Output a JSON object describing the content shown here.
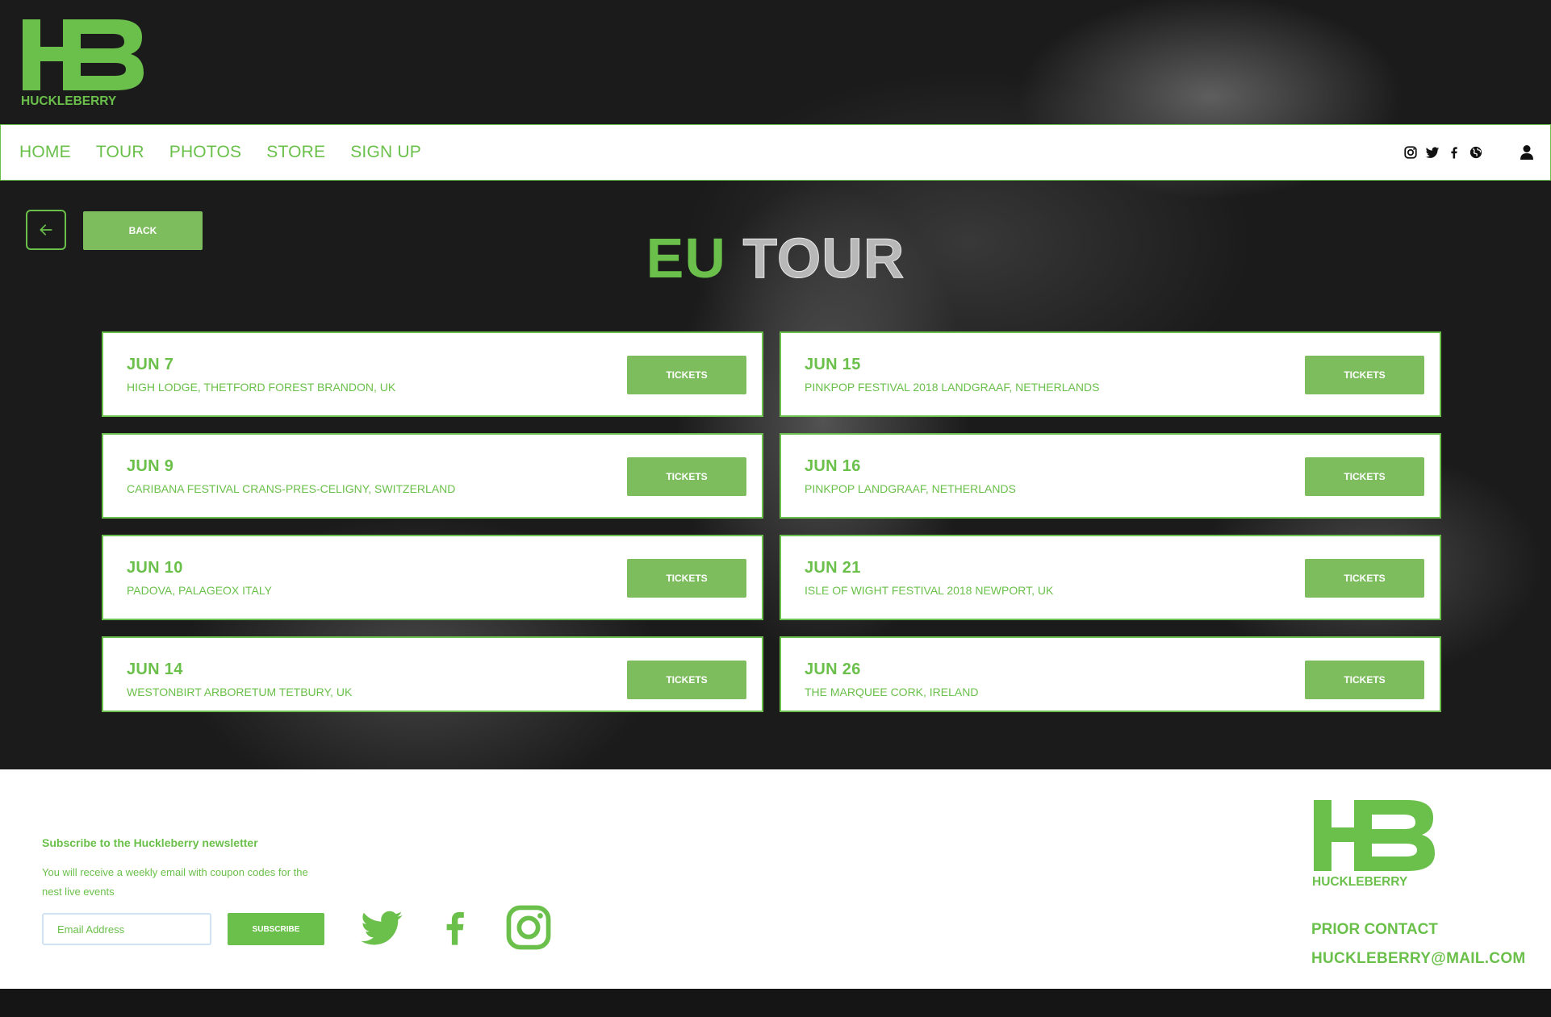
{
  "brand": {
    "logo_mark": "HB",
    "logo_name": "HUCKLEBERRY",
    "accent_color": "#6ac04a"
  },
  "nav": {
    "items": [
      {
        "label": "HOME"
      },
      {
        "label": "TOUR"
      },
      {
        "label": "PHOTOS"
      },
      {
        "label": "STORE"
      },
      {
        "label": "SIGN UP"
      }
    ],
    "icons": [
      "instagram-icon",
      "twitter-icon",
      "facebook-icon",
      "globe-icon",
      "user-icon"
    ]
  },
  "controls": {
    "back_label": "BACK"
  },
  "page": {
    "title_accent": "EU",
    "title_rest": "TOUR"
  },
  "tour": {
    "tickets_label": "TICKETS",
    "dates": [
      {
        "date": "JUN 7",
        "venue": "HIGH LODGE, THETFORD FOREST BRANDON, UK"
      },
      {
        "date": "JUN 15",
        "venue": "PINKPOP FESTIVAL 2018 LANDGRAAF, NETHERLANDS"
      },
      {
        "date": "JUN 9",
        "venue": "CARIBANA FESTIVAL CRANS-PRES-CELIGNY, SWITZERLAND"
      },
      {
        "date": "JUN 16",
        "venue": "PINKPOP LANDGRAAF, NETHERLANDS"
      },
      {
        "date": "JUN 10",
        "venue": "PADOVA, PALAGEOX ITALY"
      },
      {
        "date": "JUN 21",
        "venue": "ISLE OF WIGHT FESTIVAL 2018 NEWPORT, UK"
      },
      {
        "date": "JUN 14",
        "venue": "WESTONBIRT ARBORETUM TETBURY, UK"
      },
      {
        "date": "JUN 26",
        "venue": "THE MARQUEE CORK, IRELAND"
      }
    ]
  },
  "footer": {
    "newsletter_title": "Subscribe to the Huckleberry newsletter",
    "newsletter_desc": "You will receive a weekly email with coupon codes for the nest live events",
    "email_placeholder": "Email Address",
    "subscribe_label": "SUBSCRIBE",
    "social_icons": [
      "twitter-icon",
      "facebook-icon",
      "instagram-icon"
    ],
    "contact_label": "PRIOR CONTACT",
    "contact_email": "HUCKLEBERRY@MAIL.COM"
  }
}
